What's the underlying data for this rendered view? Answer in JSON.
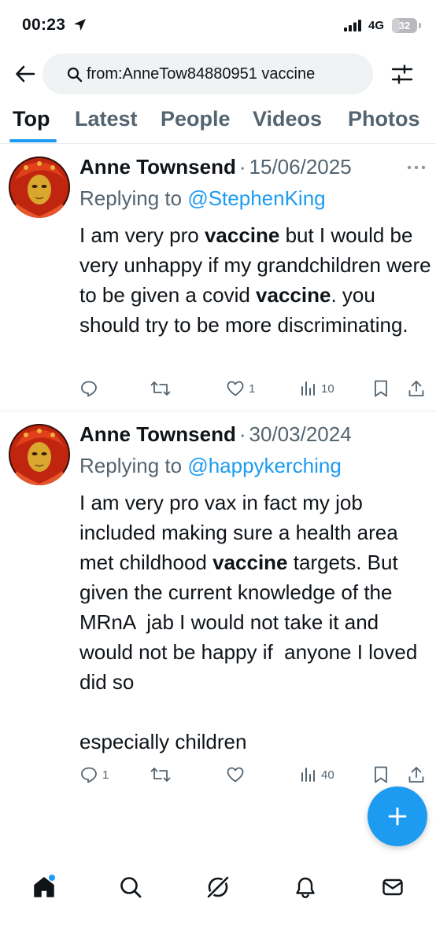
{
  "status_bar": {
    "time": "00:23",
    "network": "4G",
    "battery": "32",
    "battery_level": 0.32
  },
  "search": {
    "query": "from:AnneTow84880951 vaccine"
  },
  "tabs": [
    {
      "label": "Top",
      "active": true
    },
    {
      "label": "Latest",
      "active": false
    },
    {
      "label": "People",
      "active": false
    },
    {
      "label": "Videos",
      "active": false
    },
    {
      "label": "Photos",
      "active": false
    }
  ],
  "tweets": [
    {
      "author": "Anne Townsend",
      "separator": "·",
      "date": "15/06/2025",
      "replying_prefix": "Replying to",
      "replying_handle": "@StephenKing",
      "body_segments": [
        {
          "text": "I am very pro ",
          "bold": false
        },
        {
          "text": "vaccine",
          "bold": true
        },
        {
          "text": " but I would be very unhappy if my grandchildren were to be given a covid ",
          "bold": false
        },
        {
          "text": "vaccine",
          "bold": true
        },
        {
          "text": ". you should try to be more discriminating.",
          "bold": false
        }
      ],
      "actions": {
        "replies": "",
        "retweets": "",
        "likes": "1",
        "views": "10"
      }
    },
    {
      "author": "Anne Townsend",
      "separator": "·",
      "date": "30/03/2024",
      "replying_prefix": "Replying to",
      "replying_handle": "@happykerching",
      "body_segments": [
        {
          "text": "I am very pro vax in fact my job included making sure a health area met childhood ",
          "bold": false
        },
        {
          "text": "vaccine",
          "bold": true
        },
        {
          "text": " targets. But given the current knowledge of the MRnA  jab I would not take it and would not be happy if  anyone I loved did so",
          "bold": false
        },
        {
          "text": "\n\nespecially children",
          "bold": false
        }
      ],
      "actions": {
        "replies": "1",
        "retweets": "",
        "likes": "",
        "views": "40"
      }
    }
  ],
  "colors": {
    "accent": "#1d9bf0",
    "secondary_text": "#536471",
    "primary_text": "#0f1419",
    "divider": "#e6ecf0",
    "search_bg": "#eff3f4"
  },
  "icons": {
    "status": [
      "location-arrow-icon",
      "signal-icon",
      "battery-icon"
    ],
    "header": [
      "back-arrow-icon",
      "search-icon",
      "filter-icon"
    ],
    "tweet_actions": [
      "reply-icon",
      "retweet-icon",
      "like-icon",
      "views-icon",
      "bookmark-icon",
      "share-icon"
    ],
    "bottom_nav": [
      "home-icon",
      "explore-icon",
      "grok-icon",
      "notifications-icon",
      "messages-icon"
    ],
    "fab": "compose-plus-icon"
  }
}
